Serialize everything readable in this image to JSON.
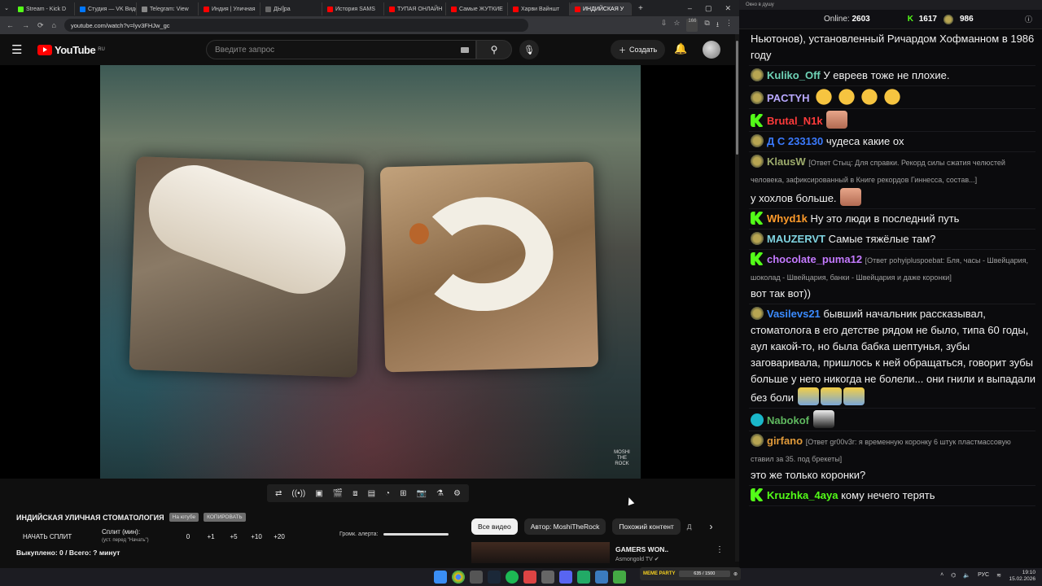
{
  "browser": {
    "tabs": [
      {
        "label": "Stream - Kick D",
        "color": "#53fc18"
      },
      {
        "label": "Студия — VK Видео",
        "color": "#0077ff"
      },
      {
        "label": "Telegram: View",
        "color": "#888888"
      },
      {
        "label": "Индия | Уличная",
        "color": "#ff0000"
      },
      {
        "label": "ДЫ]ра",
        "color": "#666666"
      },
      {
        "label": "История SAMS",
        "color": "#ff0000"
      },
      {
        "label": "ТУПАЯ ОНЛАЙН",
        "color": "#ff0000"
      },
      {
        "label": "Самые ЖУТКИЕ",
        "color": "#ff0000"
      },
      {
        "label": "Харви Вайншт",
        "color": "#ff0000"
      },
      {
        "label": "ИНДИЙСКАЯ У",
        "color": "#ff0000"
      }
    ],
    "url": "youtube.com/watch?v=lyv3FHJw_gc",
    "ext_count": "166"
  },
  "youtube": {
    "logo_text": "YouTube",
    "region": "RU",
    "search_placeholder": "Введите запрос",
    "create_label": "Создать"
  },
  "video": {
    "watermark": "MOSHI THE ROCK",
    "title": "ИНДИЙСКАЯ УЛИЧНАЯ СТОМАТОЛОГИЯ",
    "chip_search": "На ютубе",
    "chip_copy": "КОПИРОВАТЬ"
  },
  "split": {
    "start_label": "НАЧАТЬ СПЛИТ",
    "label": "Сплит (мин):",
    "hint": "(уст. перед \"Начать\")",
    "value": "0",
    "increments": [
      "+1",
      "+5",
      "+10",
      "+20"
    ],
    "alert_label": "Громк. алерта:",
    "bought": "Выкуплено: 0 / Всего: ? минут"
  },
  "filters": [
    "Все видео",
    "Автор: MoshiTheRock",
    "Похожий контент",
    "Д"
  ],
  "recommendation": {
    "title": "GAMERS WON..",
    "channel": "Asmongold TV"
  },
  "chat": {
    "window_title": "Окно в душу",
    "online_label": "Online:",
    "online_count": "2603",
    "kick_count": "1617",
    "sub_count": "986",
    "messages": [
      {
        "badge": "",
        "user": "",
        "color": "#ffffff",
        "reply": "",
        "text": "Ньютонов), установленный Ричардом Хофманном в 1986 году",
        "emotes": []
      },
      {
        "badge": "sub",
        "user": "Kuliko_Off",
        "color": "#6fd3b6",
        "reply": "",
        "text": "У евреев тоже не плохие.",
        "emotes": []
      },
      {
        "badge": "sub",
        "user": "PACTYH",
        "color": "#b9a9ff",
        "reply": "",
        "text": "",
        "emotes": [
          "laugh",
          "laugh",
          "laugh",
          "laugh"
        ]
      },
      {
        "badge": "k",
        "user": "Brutal_N1k",
        "color": "#ff3b3b",
        "reply": "",
        "text": "",
        "emotes": [
          "face"
        ]
      },
      {
        "badge": "sub",
        "user": "Д С 233130",
        "color": "#3b7bff",
        "reply": "",
        "text": "чудеса какие ох",
        "emotes": []
      },
      {
        "badge": "sub",
        "user": "KlausW",
        "color": "#9dab6c",
        "reply": "[Ответ Стыц: Для справки. Рекорд силы сжатия челюстей человека, зафиксированный в Книге рекордов Гиннесса, состав...]",
        "text": "у хохлов больше.",
        "emotes": [
          "face"
        ]
      },
      {
        "badge": "k",
        "user": "Whyd1k",
        "color": "#ff9b2b",
        "reply": "",
        "text": "Ну это люди в последний путь",
        "emotes": []
      },
      {
        "badge": "sub",
        "user": "MAUZERVT",
        "color": "#7fd3e0",
        "reply": "",
        "text": "Самые тяжёлые там?",
        "emotes": []
      },
      {
        "badge": "k",
        "user": "chocolate_puma12",
        "color": "#c47aff",
        "reply": "[Ответ pohyipluspoebat: Бля, часы - Швейцария, шоколад - Швейцария, банки - Швейцария и даже коронки]",
        "text": "вот так вот))",
        "emotes": []
      },
      {
        "badge": "sub",
        "user": "Vasilevs21",
        "color": "#3b8bff",
        "reply": "",
        "text": "бывший начальник рассказывал, стоматолога в его детстве рядом не было, типа 60 годы, аул какой-то, но была бабка шептунья, зубы заговаривала, пришлось к ней обращаться, говорит зубы больше у него никогда не болели... они гнили и выпадали без боли",
        "emotes": [
          "pepe",
          "pepe",
          "pepe"
        ]
      },
      {
        "badge": "ver",
        "user": "Nabokof",
        "color": "#5fb85f",
        "reply": "",
        "text": "",
        "emotes": [
          "bw"
        ]
      },
      {
        "badge": "sub",
        "user": "girfano",
        "color": "#e09a3a",
        "reply": "[Ответ gr00v3r: я временную коронку 6 штук пластмассовую ставил за 35. под брекеты]",
        "text": "это же только коронки?",
        "emotes": []
      },
      {
        "badge": "k",
        "user": "Kruzhka_4aya",
        "color": "#53fc18",
        "reply": "",
        "text": "кому нечего терять",
        "emotes": []
      }
    ]
  },
  "overlay": {
    "title": "MEME PARTY",
    "progress": "635 / 1500"
  },
  "taskbar": {
    "lang": "РУС",
    "time": "19:10",
    "date": "15.02.2026"
  }
}
